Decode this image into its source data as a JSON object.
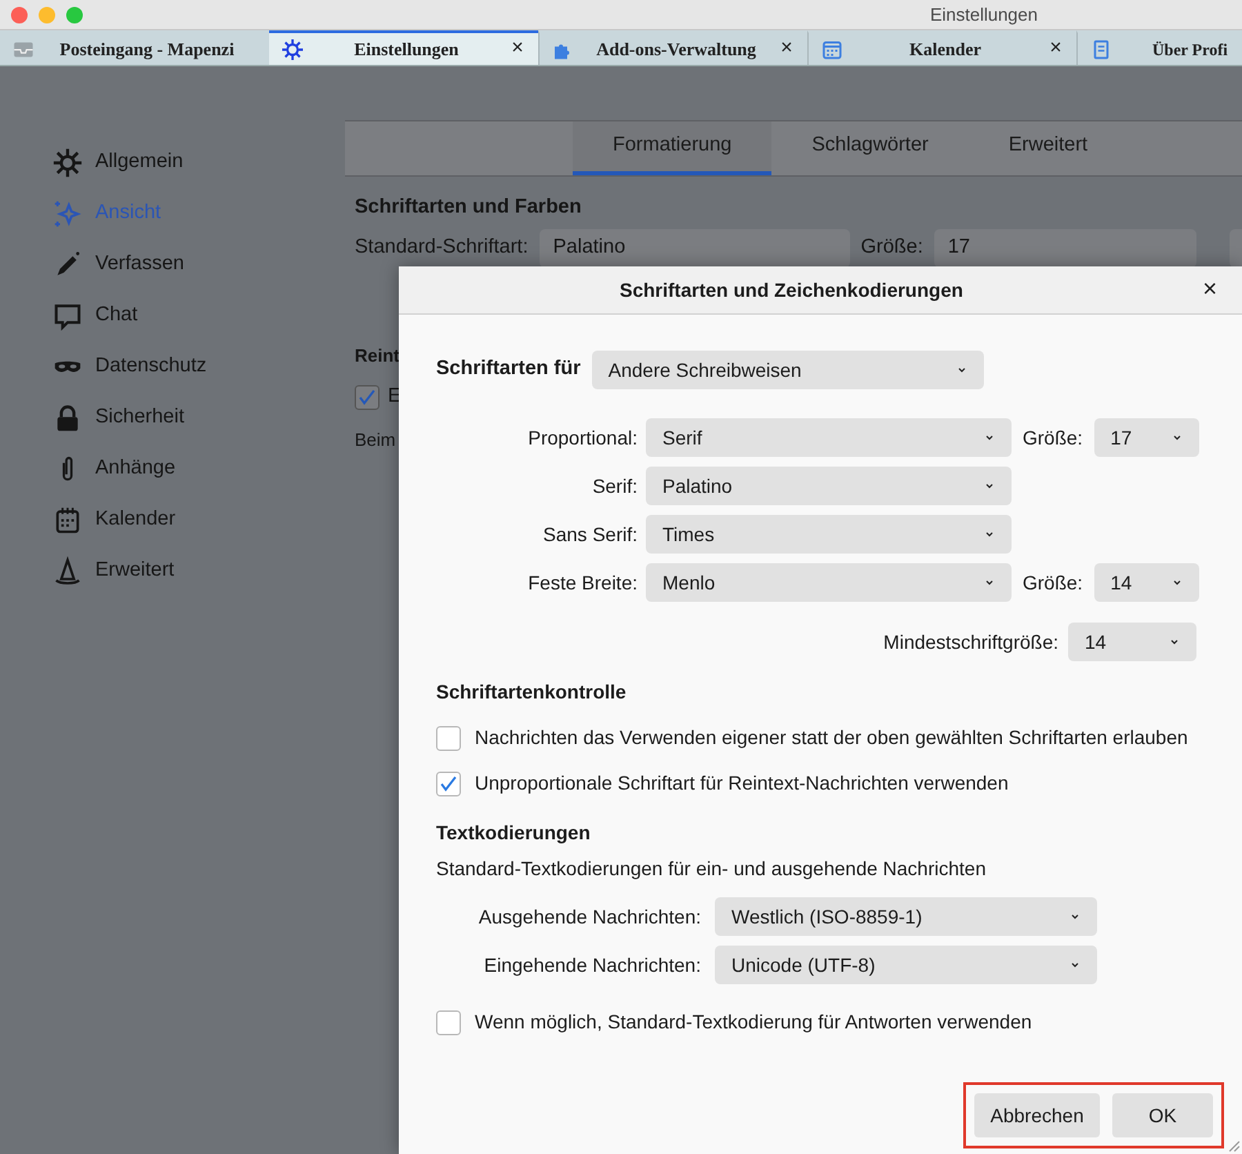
{
  "window": {
    "title": "Einstellungen"
  },
  "tabs": [
    {
      "label": "Posteingang - Mapenzi",
      "selected": false,
      "closable": false
    },
    {
      "label": "Einstellungen",
      "selected": true,
      "closable": true
    },
    {
      "label": "Add-ons-Verwaltung",
      "selected": false,
      "closable": true
    },
    {
      "label": "Kalender",
      "selected": false,
      "closable": true
    },
    {
      "label": "Über Profi",
      "selected": false,
      "closable": false
    }
  ],
  "tab_close": "×",
  "sidebar": {
    "items": [
      {
        "label": "Allgemein",
        "selected": false
      },
      {
        "label": "Ansicht",
        "selected": true
      },
      {
        "label": "Verfassen",
        "selected": false
      },
      {
        "label": "Chat",
        "selected": false
      },
      {
        "label": "Datenschutz",
        "selected": false
      },
      {
        "label": "Sicherheit",
        "selected": false
      },
      {
        "label": "Anhänge",
        "selected": false
      },
      {
        "label": "Kalender",
        "selected": false
      },
      {
        "label": "Erweitert",
        "selected": false
      }
    ]
  },
  "settings_tabs": [
    {
      "label": "Formatierung",
      "selected": true
    },
    {
      "label": "Schlagwörter",
      "selected": false
    },
    {
      "label": "Erweitert",
      "selected": false
    }
  ],
  "background": {
    "heading": "Schriftarten und Farben",
    "font_label": "Standard-Schriftart:",
    "font_value": "Palatino",
    "size_label": "Größe:",
    "size_value": "17",
    "section_2": "Reint",
    "checkbox": {
      "label": "E",
      "checked": true
    },
    "text_3": "Beim"
  },
  "dialog": {
    "title": "Schriftarten und Zeichenkodierungen",
    "close": "×",
    "fonts_for": {
      "label": "Schriftarten für",
      "value": "Andere Schreibweisen"
    },
    "font_rows": [
      {
        "label": "Proportional:",
        "value": "Serif",
        "size_label": "Größe:",
        "size": "17"
      },
      {
        "label": "Serif:",
        "value": "Palatino"
      },
      {
        "label": "Sans Serif:",
        "value": "Times"
      },
      {
        "label": "Feste Breite:",
        "value": "Menlo",
        "size_label": "Größe:",
        "size": "14"
      }
    ],
    "min_size": {
      "label": "Mindestschriftgröße:",
      "value": "14"
    },
    "font_control": {
      "heading": "Schriftartenkontrolle",
      "checkboxes": [
        {
          "label": "Nachrichten das Verwenden eigener statt der oben gewählten Schriftarten erlauben",
          "checked": false
        },
        {
          "label": "Unproportionale Schriftart für Reintext-Nachrichten verwenden",
          "checked": true
        }
      ]
    },
    "encodings": {
      "heading": "Textkodierungen",
      "description": "Standard-Textkodierungen für ein- und ausgehende Nachrichten",
      "rows": [
        {
          "label": "Ausgehende Nachrichten:",
          "value": "Westlich (ISO-8859-1)"
        },
        {
          "label": "Eingehende Nachrichten:",
          "value": "Unicode (UTF-8)"
        }
      ]
    },
    "reply_checkbox": {
      "label": "Wenn möglich, Standard-Textkodierung für Antworten verwenden",
      "checked": false
    },
    "buttons_highlighted": true,
    "buttons": [
      {
        "label": "Abbrechen"
      },
      {
        "label": "OK"
      }
    ]
  }
}
